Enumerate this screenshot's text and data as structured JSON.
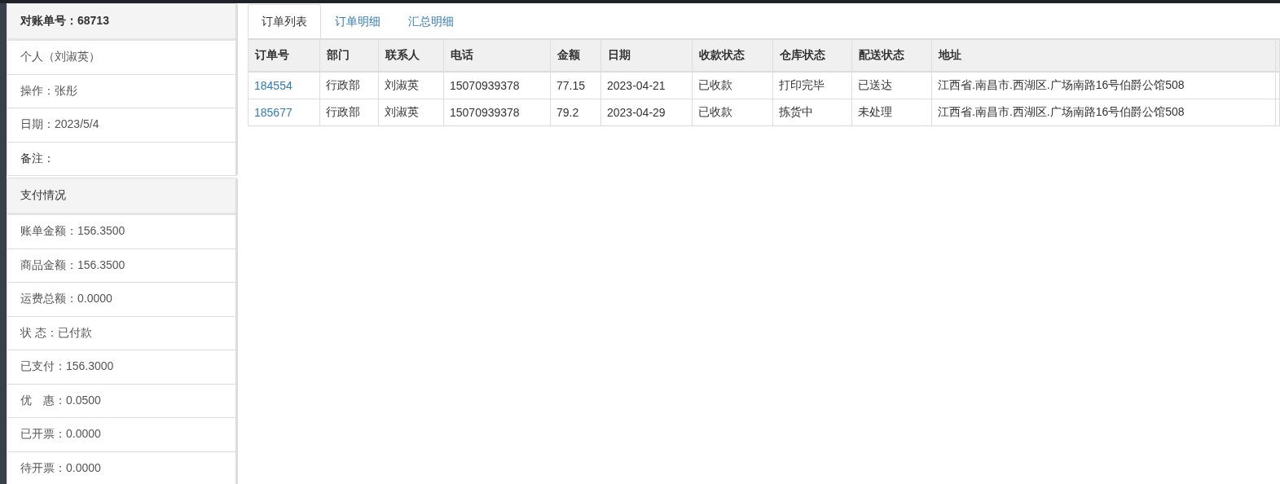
{
  "summary_panel": {
    "title": "对账单号：68713",
    "items": [
      "个人（刘淑英）",
      "操作：张彤",
      "日期：2023/5/4"
    ],
    "remark": "备注："
  },
  "payment_panel": {
    "title": "支付情况",
    "items": [
      "账单金额：156.3500",
      "商品金额：156.3500",
      "运费总额：0.0000",
      "状 态：已付款",
      "已支付：156.3000",
      "优　惠：0.0500",
      "已开票：0.0000",
      "待开票：0.0000"
    ]
  },
  "tabs": [
    {
      "label": "订单列表",
      "selected": true
    },
    {
      "label": "订单明细",
      "selected": false
    },
    {
      "label": "汇总明细",
      "selected": false
    }
  ],
  "table": {
    "columns": [
      {
        "label": "订单号",
        "kind": "link"
      },
      {
        "label": "部门",
        "kind": "text"
      },
      {
        "label": "联系人",
        "kind": "text"
      },
      {
        "label": "电话",
        "kind": "text"
      },
      {
        "label": "金额",
        "kind": "text"
      },
      {
        "label": "日期",
        "kind": "text"
      },
      {
        "label": "收款状态",
        "kind": "text"
      },
      {
        "label": "仓库状态",
        "kind": "text"
      },
      {
        "label": "配送状态",
        "kind": "text"
      },
      {
        "label": "地址",
        "kind": "text"
      }
    ],
    "rows": [
      [
        "184554",
        "行政部",
        "刘淑英",
        "15070939378",
        "77.15",
        "2023-04-21",
        "已收款",
        "打印完毕",
        "已送达",
        "江西省.南昌市.西湖区.广场南路16号伯爵公馆508"
      ],
      [
        "185677",
        "行政部",
        "刘淑英",
        "15070939378",
        "79.2",
        "2023-04-29",
        "已收款",
        "拣货中",
        "未处理",
        "江西省.南昌市.西湖区.广场南路16号伯爵公馆508"
      ]
    ]
  }
}
